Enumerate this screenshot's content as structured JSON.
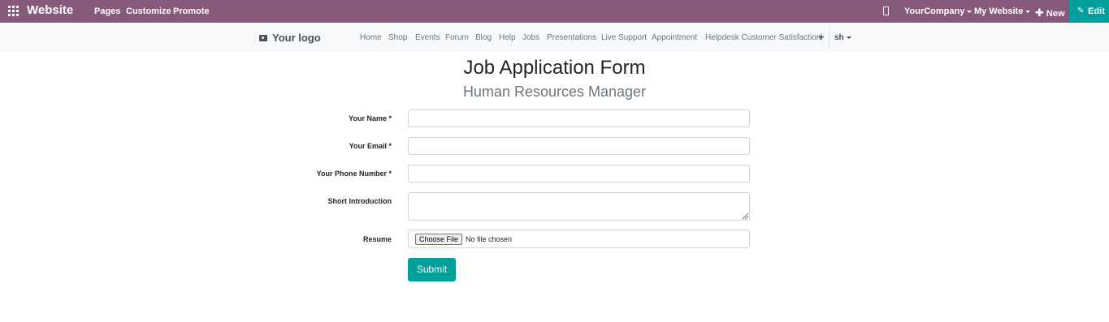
{
  "topbar": {
    "brand": "Website",
    "menu": [
      "Pages",
      "Customize",
      "Promote"
    ],
    "company": "YourCompany",
    "my_website": "My Website",
    "new_label": "New",
    "edit_label": "Edit",
    "bg_color": "#875a7b",
    "edit_color": "#00a09d",
    "icons": {
      "apps": "apps-grid-icon",
      "mobile": "mobile-preview-icon",
      "new": "plus-icon",
      "edit": "pencil-icon"
    }
  },
  "navbar": {
    "logo": "Your logo",
    "links": [
      "Home",
      "Shop",
      "Events",
      "Forum",
      "Blog",
      "Help",
      "Jobs",
      "Presentations",
      "Live Support",
      "Appointment",
      "Helpdesk Customer Satisfaction"
    ],
    "plus": "+",
    "lang": "sh"
  },
  "form": {
    "title": "Job Application Form",
    "subtitle": "Human Resources Manager",
    "fields": [
      {
        "label": "Your Name *",
        "value": ""
      },
      {
        "label": "Your Email *",
        "value": ""
      },
      {
        "label": "Your Phone Number *",
        "value": ""
      },
      {
        "label": "Short Introduction",
        "value": ""
      },
      {
        "label": "Resume",
        "button": "Choose File",
        "status": "No file chosen"
      }
    ],
    "submit": "Submit",
    "accent_color": "#00a09d"
  }
}
